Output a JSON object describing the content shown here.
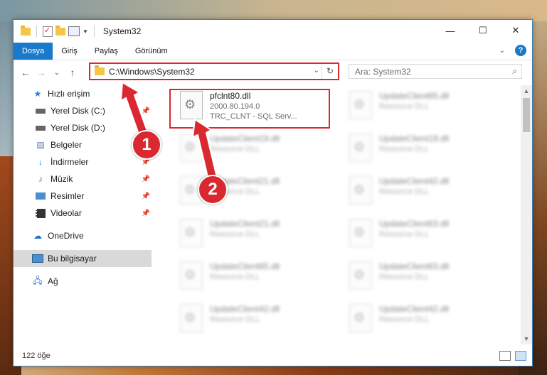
{
  "window": {
    "title": "System32",
    "controls": {
      "minimize": "—",
      "maximize": "☐",
      "close": "✕"
    }
  },
  "ribbon": {
    "tabs": [
      "Dosya",
      "Giriş",
      "Paylaş",
      "Görünüm"
    ],
    "active_tab": 0,
    "help_label": "?"
  },
  "navigation": {
    "back": "←",
    "forward": "→",
    "recent": "⌄",
    "up": "↑",
    "address": "C:\\Windows\\System32",
    "search_placeholder": "Ara: System32"
  },
  "sidebar": {
    "quick_access": "Hızlı erişim",
    "quick_items": [
      {
        "label": "Yerel Disk (C:)",
        "icon": "drive-icon",
        "pinned": true
      },
      {
        "label": "Yerel Disk (D:)",
        "icon": "drive-icon",
        "pinned": false
      },
      {
        "label": "Belgeler",
        "icon": "documents-icon",
        "pinned": false
      },
      {
        "label": "İndirmeler",
        "icon": "downloads-icon",
        "pinned": true
      },
      {
        "label": "Müzik",
        "icon": "music-icon",
        "pinned": true
      },
      {
        "label": "Resimler",
        "icon": "pictures-icon",
        "pinned": true
      },
      {
        "label": "Videolar",
        "icon": "videos-icon",
        "pinned": true
      }
    ],
    "onedrive": "OneDrive",
    "this_pc": "Bu bilgisayar",
    "network": "Ağ"
  },
  "files": [
    {
      "name": "pfclnt80.dll",
      "line2": "2000.80.194.0",
      "line3": "TRC_CLNT - SQL Serv...",
      "highlighted": true
    },
    {
      "name": "UpdateClient65.dll",
      "line2": "Resource DLL"
    },
    {
      "name": "UpdateClient19.dll",
      "line2": "Resource DLL"
    },
    {
      "name": "UpdateClient19.dll",
      "line2": "Resource DLL"
    },
    {
      "name": "UpdateClient21.dll",
      "line2": "Resource DLL"
    },
    {
      "name": "UpdateClient42.dll",
      "line2": "Resource DLL"
    },
    {
      "name": "UpdateClient21.dll",
      "line2": "Resource DLL"
    },
    {
      "name": "UpdateClient63.dll",
      "line2": "Resource DLL"
    },
    {
      "name": "UpdateClient65.dll",
      "line2": "Resource DLL"
    },
    {
      "name": "UpdateClient63.dll",
      "line2": "Resource DLL"
    },
    {
      "name": "UpdateClient42.dll",
      "line2": "Resource DLL"
    },
    {
      "name": "UpdateClient42.dll",
      "line2": "Resource DLL"
    }
  ],
  "status": {
    "item_count": "122 öğe"
  },
  "annotations": {
    "badge1": "1",
    "badge2": "2",
    "color": "#d9282f"
  }
}
